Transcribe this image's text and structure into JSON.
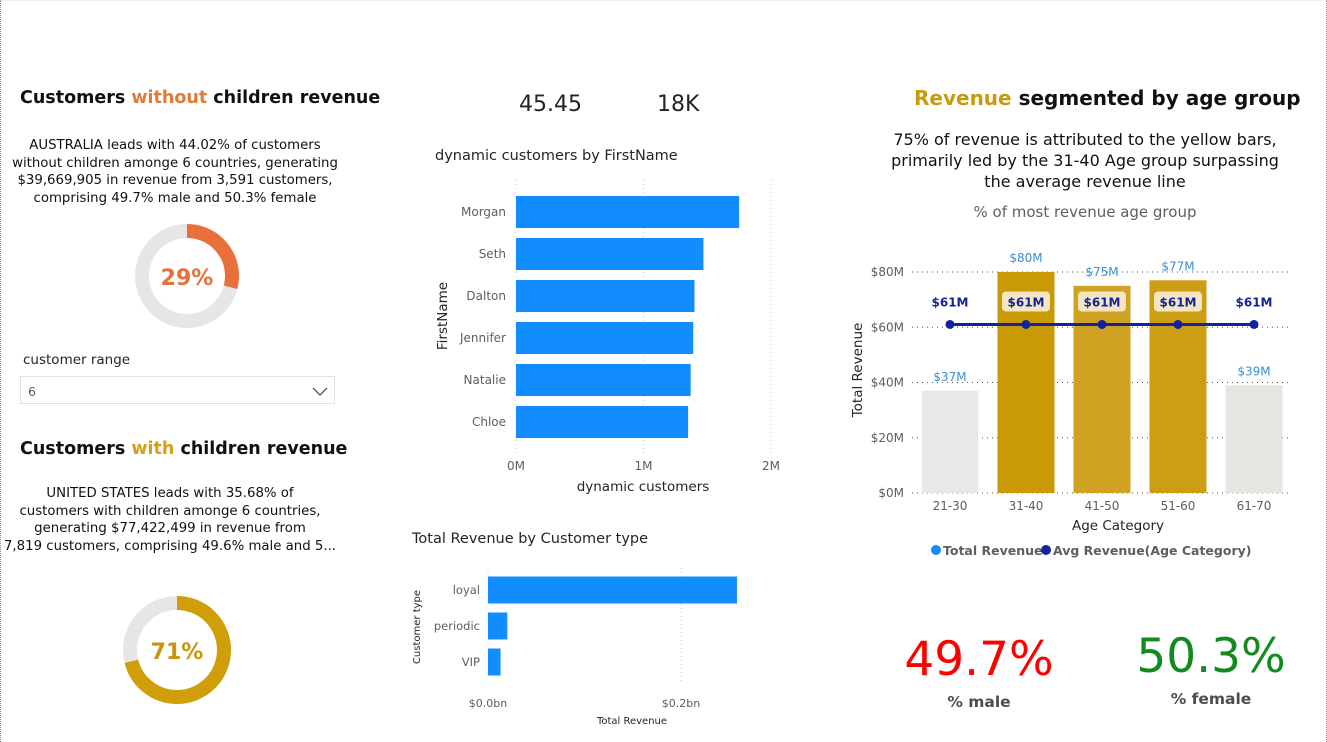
{
  "left": {
    "top_title": {
      "pre": "Customers ",
      "accent": "without",
      "post": " children revenue",
      "accent_color": "#e07b39"
    },
    "top_narrative": [
      "AUSTRALIA leads with 44.02% of customers",
      "without children amonge 6 countries, generating",
      "$39,669,905 in revenue from 3,591 customers,",
      "comprising 49.7% male and 50.3% female"
    ],
    "top_donut": {
      "value_label": "29%",
      "fraction": 0.29,
      "color": "#e8703a",
      "track": "#e6e6e6"
    },
    "slicer": {
      "label": "customer range",
      "value": "6"
    },
    "bottom_title": {
      "pre": "Customers ",
      "accent": "with",
      "post": " children revenue",
      "accent_color": "#d4a017"
    },
    "bottom_narrative": [
      "UNITED STATES leads with 35.68% of",
      "customers with children amonge 6 countries,",
      "generating $77,422,499 in revenue from",
      "7,819 customers, comprising 49.6% male and 5..."
    ],
    "bottom_donut": {
      "value_label": "71%",
      "fraction": 0.71,
      "color": "#cf9e08",
      "track": "#e6e6e6"
    }
  },
  "kpis": {
    "first": "45.45",
    "second": "18K"
  },
  "firstname_chart": {
    "title": "dynamic customers by FirstName"
  },
  "customer_type_chart": {
    "title": "Total Revenue by Customer type"
  },
  "age_chart": {
    "title_accent": "Revenue",
    "title_rest": " segmented by age group",
    "accent_color": "#c89a10",
    "narrative": [
      "75% of revenue is attributed to the yellow bars,",
      "primarily led by the 31-40 Age group surpassing",
      "the average revenue line"
    ],
    "subtitle": "% of most revenue age group"
  },
  "gender": {
    "male_value": "49.7%",
    "male_label": "% male",
    "male_color": "#ff0000",
    "female_value": "50.3%",
    "female_label": "% female",
    "female_color": "#118b1d"
  },
  "chart_data": [
    {
      "type": "bar",
      "orientation": "horizontal",
      "title": "dynamic customers by FirstName",
      "xlabel": "dynamic customers",
      "ylabel": "FirstName",
      "categories": [
        "Morgan",
        "Seth",
        "Dalton",
        "Jennifer",
        "Natalie",
        "Chloe"
      ],
      "values": [
        1750000,
        1470000,
        1400000,
        1390000,
        1370000,
        1350000
      ],
      "xlim": [
        0,
        2000000
      ],
      "xticks": [
        "0M",
        "1M",
        "2M"
      ],
      "grid": true,
      "color": "#118dff"
    },
    {
      "type": "bar",
      "orientation": "horizontal",
      "title": "Total Revenue by Customer type",
      "xlabel": "Total Revenue",
      "ylabel": "Customer type",
      "categories": [
        "loyal",
        "periodic",
        "VIP"
      ],
      "values": [
        0.258,
        0.02,
        0.013
      ],
      "unit": "bn",
      "xticks": [
        "$0.0bn",
        "$0.2bn"
      ],
      "grid": true,
      "color": "#118dff"
    },
    {
      "type": "bar",
      "title": "",
      "xlabel": "Age Category",
      "ylabel": "Total Revenue",
      "categories": [
        "21-30",
        "31-40",
        "41-50",
        "51-60",
        "61-70"
      ],
      "series": [
        {
          "name": "Total Revenue",
          "values": [
            37,
            80,
            75,
            77,
            39
          ],
          "labels": [
            "$37M",
            "$80M",
            "$75M",
            "$77M",
            "$39M"
          ],
          "colors": [
            "#e8e8e8",
            "#c99a06",
            "#cfa221",
            "#cd9e14",
            "#e6e5e1"
          ],
          "legend_color": "#118dff"
        },
        {
          "name": "Avg Revenue(Age Category)",
          "type": "line",
          "values": [
            61,
            61,
            61,
            61,
            61
          ],
          "labels": [
            "$61M",
            "$61M",
            "$61M",
            "$61M",
            "$61M"
          ],
          "color": "#12239e"
        }
      ],
      "ylim": [
        0,
        80
      ],
      "yticks": [
        "$0M",
        "$20M",
        "$40M",
        "$60M",
        "$80M"
      ],
      "legend": "bottom",
      "grid": true
    }
  ]
}
